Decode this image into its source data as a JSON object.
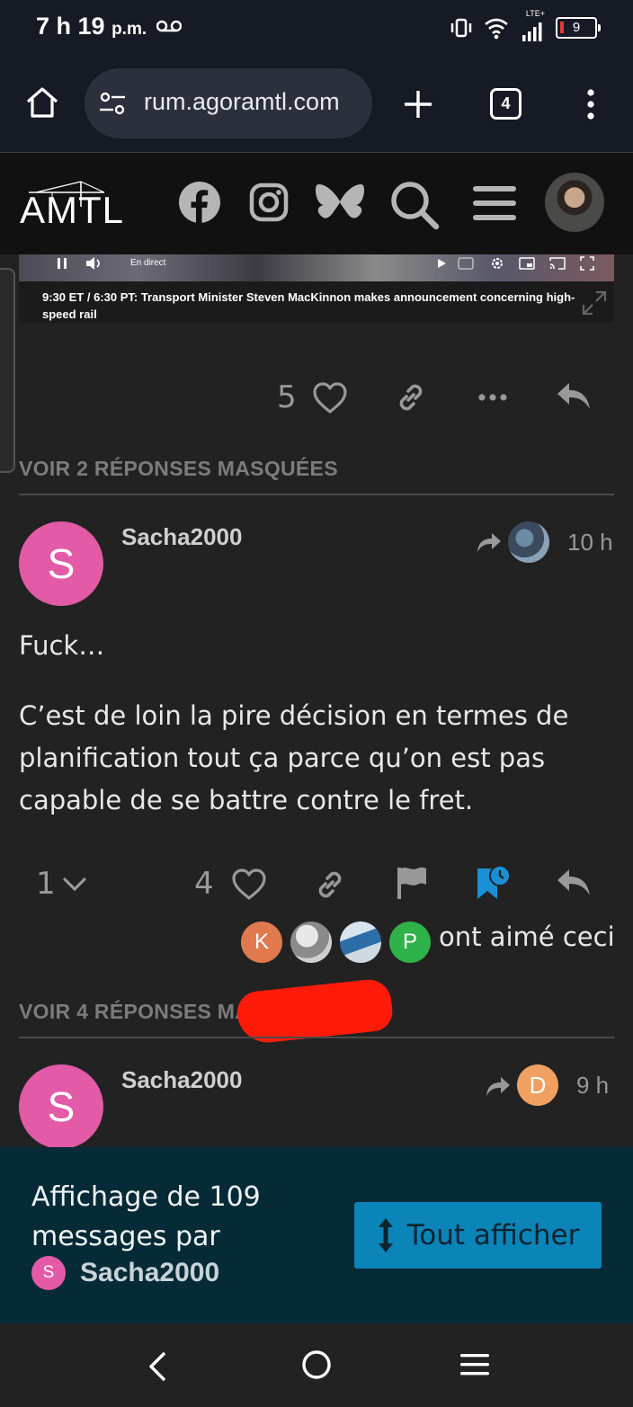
{
  "status_bar": {
    "time": "7 h 19",
    "ampm": "p.m.",
    "network": "LTE+",
    "battery": "9"
  },
  "browser": {
    "url": "rum.agoramtl.com",
    "tab_count": "4"
  },
  "site": {
    "logo": "AMTL",
    "icons": [
      "facebook-icon",
      "instagram-icon",
      "bluesky-icon",
      "search-icon",
      "menu-icon"
    ]
  },
  "video": {
    "live_label": "En direct",
    "caption": "9:30 ET / 6:30 PT: Transport Minister Steven MacKinnon makes announcement concerning high-speed rail"
  },
  "post1": {
    "like_count": "5"
  },
  "hidden_replies_1": "VOIR 2 RÉPONSES MASQUÉES",
  "post2": {
    "avatar_letter": "S",
    "username": "Sacha2000",
    "time": "10 h",
    "paragraphs": [
      "Fuck…",
      "C’est de loin la pire décision en termes de planification tout ça parce qu’on est pas capable de se battre contre le fret."
    ],
    "reply_count": "1",
    "like_count": "4",
    "likers": [
      {
        "letter": "K",
        "color": "#e07a4e"
      },
      {
        "letter": "",
        "color": "#9a9a9a"
      },
      {
        "letter": "",
        "color": "#3e6f99"
      },
      {
        "letter": "P",
        "color": "#2fb24a"
      }
    ],
    "liked_text": "ont aimé ceci",
    "bookmark_color": "#1a8fd6"
  },
  "hidden_replies_2": "VOIR 4 RÉPONSES MASQUÉES",
  "post3": {
    "avatar_letter": "S",
    "username": "Sacha2000",
    "time": "9 h",
    "reply_to_letter": "D",
    "reply_to_color": "#f0a060"
  },
  "banner": {
    "text": "Affichage de 109 messages par",
    "user_letter": "S",
    "username": "Sacha2000",
    "button_label": "Tout afficher"
  }
}
